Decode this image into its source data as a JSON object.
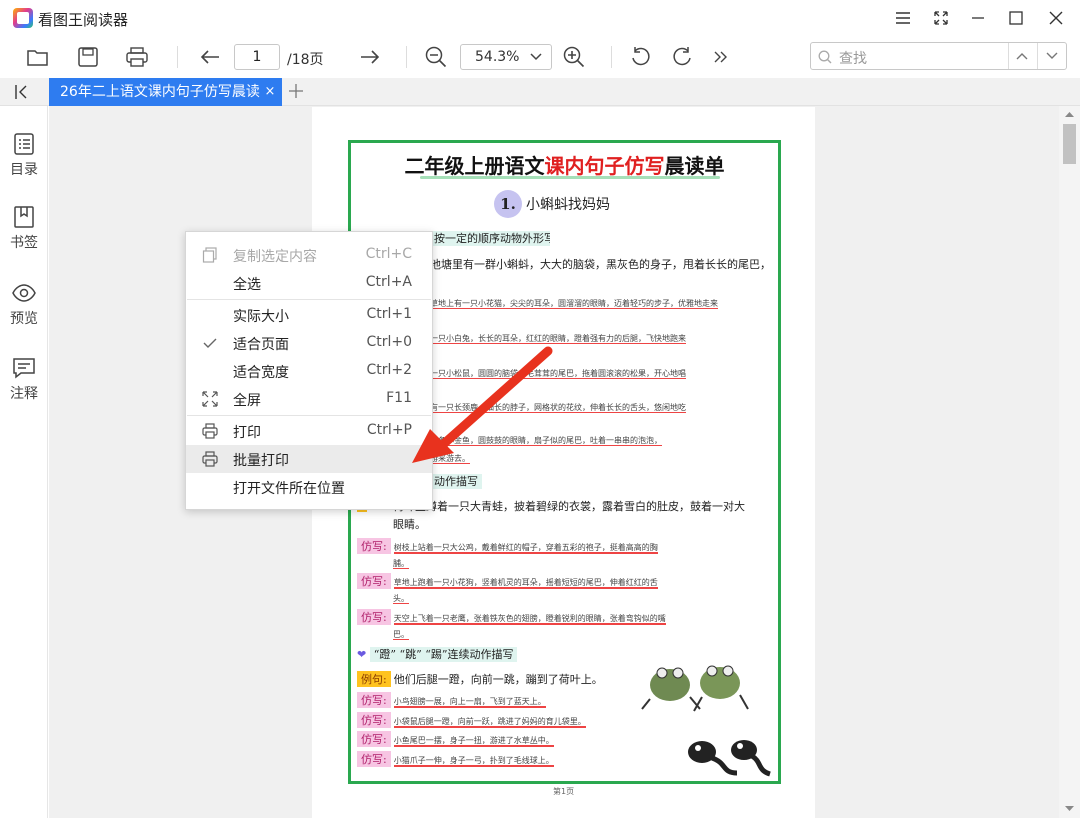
{
  "app": {
    "title": "看图王阅读器"
  },
  "toolbar": {
    "page_current": "1",
    "page_total": "/18页",
    "zoom_value": "54.3%",
    "search_placeholder": "查找"
  },
  "tabs": [
    {
      "label": "26年二上语文课内句子仿写晨读",
      "close": "×"
    }
  ],
  "sidebar": {
    "items": [
      {
        "label": "目录"
      },
      {
        "label": "书签"
      },
      {
        "label": "预览"
      },
      {
        "label": "注释"
      }
    ]
  },
  "context_menu": {
    "items": [
      {
        "label": "复制选定内容",
        "shortcut": "Ctrl+C"
      },
      {
        "label": "全选",
        "shortcut": "Ctrl+A"
      },
      {
        "label": "实际大小",
        "shortcut": "Ctrl+1"
      },
      {
        "label": "适合页面",
        "shortcut": "Ctrl+0"
      },
      {
        "label": "适合宽度",
        "shortcut": "Ctrl+2"
      },
      {
        "label": "全屏",
        "shortcut": "F11"
      },
      {
        "label": "打印",
        "shortcut": "Ctrl+P"
      },
      {
        "label": "批量打印",
        "shortcut": ""
      },
      {
        "label": "打开文件所在位置",
        "shortcut": ""
      }
    ]
  },
  "document": {
    "title_black": "二年级上册语文",
    "title_red": "课内句子仿写",
    "title_black2": "晨读单",
    "lesson_num": "1.",
    "lesson_title": "小蝌蚪找妈妈",
    "section1": "按一定的顺序动物外形写法",
    "ex1_line1": "池塘里有一群小蝌蚪，大大的脑袋，黑灰色的身子，甩着长长的尾巴，快",
    "fx1": "草地上有一只小花猫，尖尖的耳朵，圆溜溜的眼睛，迈着轻巧的步子，优雅地走来",
    "fx2": "一只小白兔，长长的耳朵，红红的眼睛，蹬着强有力的后腿，飞快地跑来",
    "fx3": "一只小松鼠，圆圆的脑袋，毛茸茸的尾巴，拖着圆滚滚的松果，开心地唱",
    "fx4": "有一只长颈鹿，细长的脖子，网格状的花纹，伸着长长的舌头，悠闲地吃",
    "fx5": "一条小金鱼，圆鼓鼓的眼睛，扇子似的尾巴，吐着一串串的泡泡，",
    "fx5_tail": "游来游去。",
    "section2": "动作描写",
    "ex2_line1": "荷叶上蹲着一只大青蛙，披着碧绿的衣裳，露着雪白的肚皮，鼓着一对大",
    "ex2_line2": "眼睛。",
    "tag_fx": "仿写:",
    "tag_ex": "例句:",
    "fxb1": "树枝上站着一只大公鸡，戴着鲜红的帽子，穿着五彩的袍子，挺着高高的胸",
    "fxb1_tail": "脯。",
    "fxb2": "草地上跑着一只小花狗，竖着机灵的耳朵，摇着短短的尾巴，伸着红红的舌",
    "fxb2_tail": "头。",
    "fxb3": "天空上飞着一只老鹰，张着铁灰色的翅膀，瞪着锐利的眼睛，张着弯钩似的嘴",
    "fxb3_tail": "巴。",
    "section3": "“蹬” “跳”  “踢”连续动作描写",
    "ex3": "他们后腿一蹬，向前一跳，蹦到了荷叶上。",
    "fxc1": "小鸟翅膀一展，向上一扇，飞到了蓝天上。",
    "fxc2": "小袋鼠后腿一蹬，向前一跃，跳进了妈妈的育儿袋里。",
    "fxc3": "小鱼尾巴一摆，身子一扭，游进了水草丛中。",
    "fxc4": "小猫爪子一伸，身子一弓，扑到了毛线球上。",
    "page_footer": "第1页"
  },
  "colors": {
    "accent": "#2e7cf0",
    "frame_green": "#2aa84f",
    "title_red": "#e02020",
    "arrow_red": "#e8321e"
  }
}
